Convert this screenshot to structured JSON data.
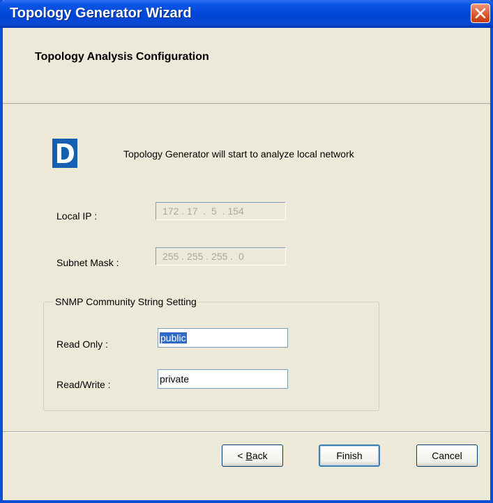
{
  "window": {
    "title": "Topology Generator Wizard"
  },
  "header": {
    "title": "Topology Analysis Configuration"
  },
  "intro": {
    "text": "Topology Generator will start to analyze local network"
  },
  "local_ip": {
    "label": "Local IP :",
    "value": "172 . 17  .  5  . 154"
  },
  "subnet_mask": {
    "label": "Subnet Mask :",
    "value": "255 . 255 . 255 .  0"
  },
  "snmp": {
    "legend": "SNMP Community String Setting",
    "read_only_label": "Read Only :",
    "read_only_value": "public",
    "read_write_label": "Read/Write :",
    "read_write_value": "private"
  },
  "buttons": {
    "back_prefix": "< ",
    "back_mnemonic": "B",
    "back_rest": "ack",
    "finish": "Finish",
    "cancel": "Cancel"
  },
  "icons": {
    "logo": "d-link-logo-icon",
    "close": "close-icon"
  },
  "colors": {
    "title_bar": "#0046d8",
    "close_button": "#d9552b",
    "logo": "#1660b2",
    "selection": "#316ac5",
    "background": "#ece9d8"
  }
}
